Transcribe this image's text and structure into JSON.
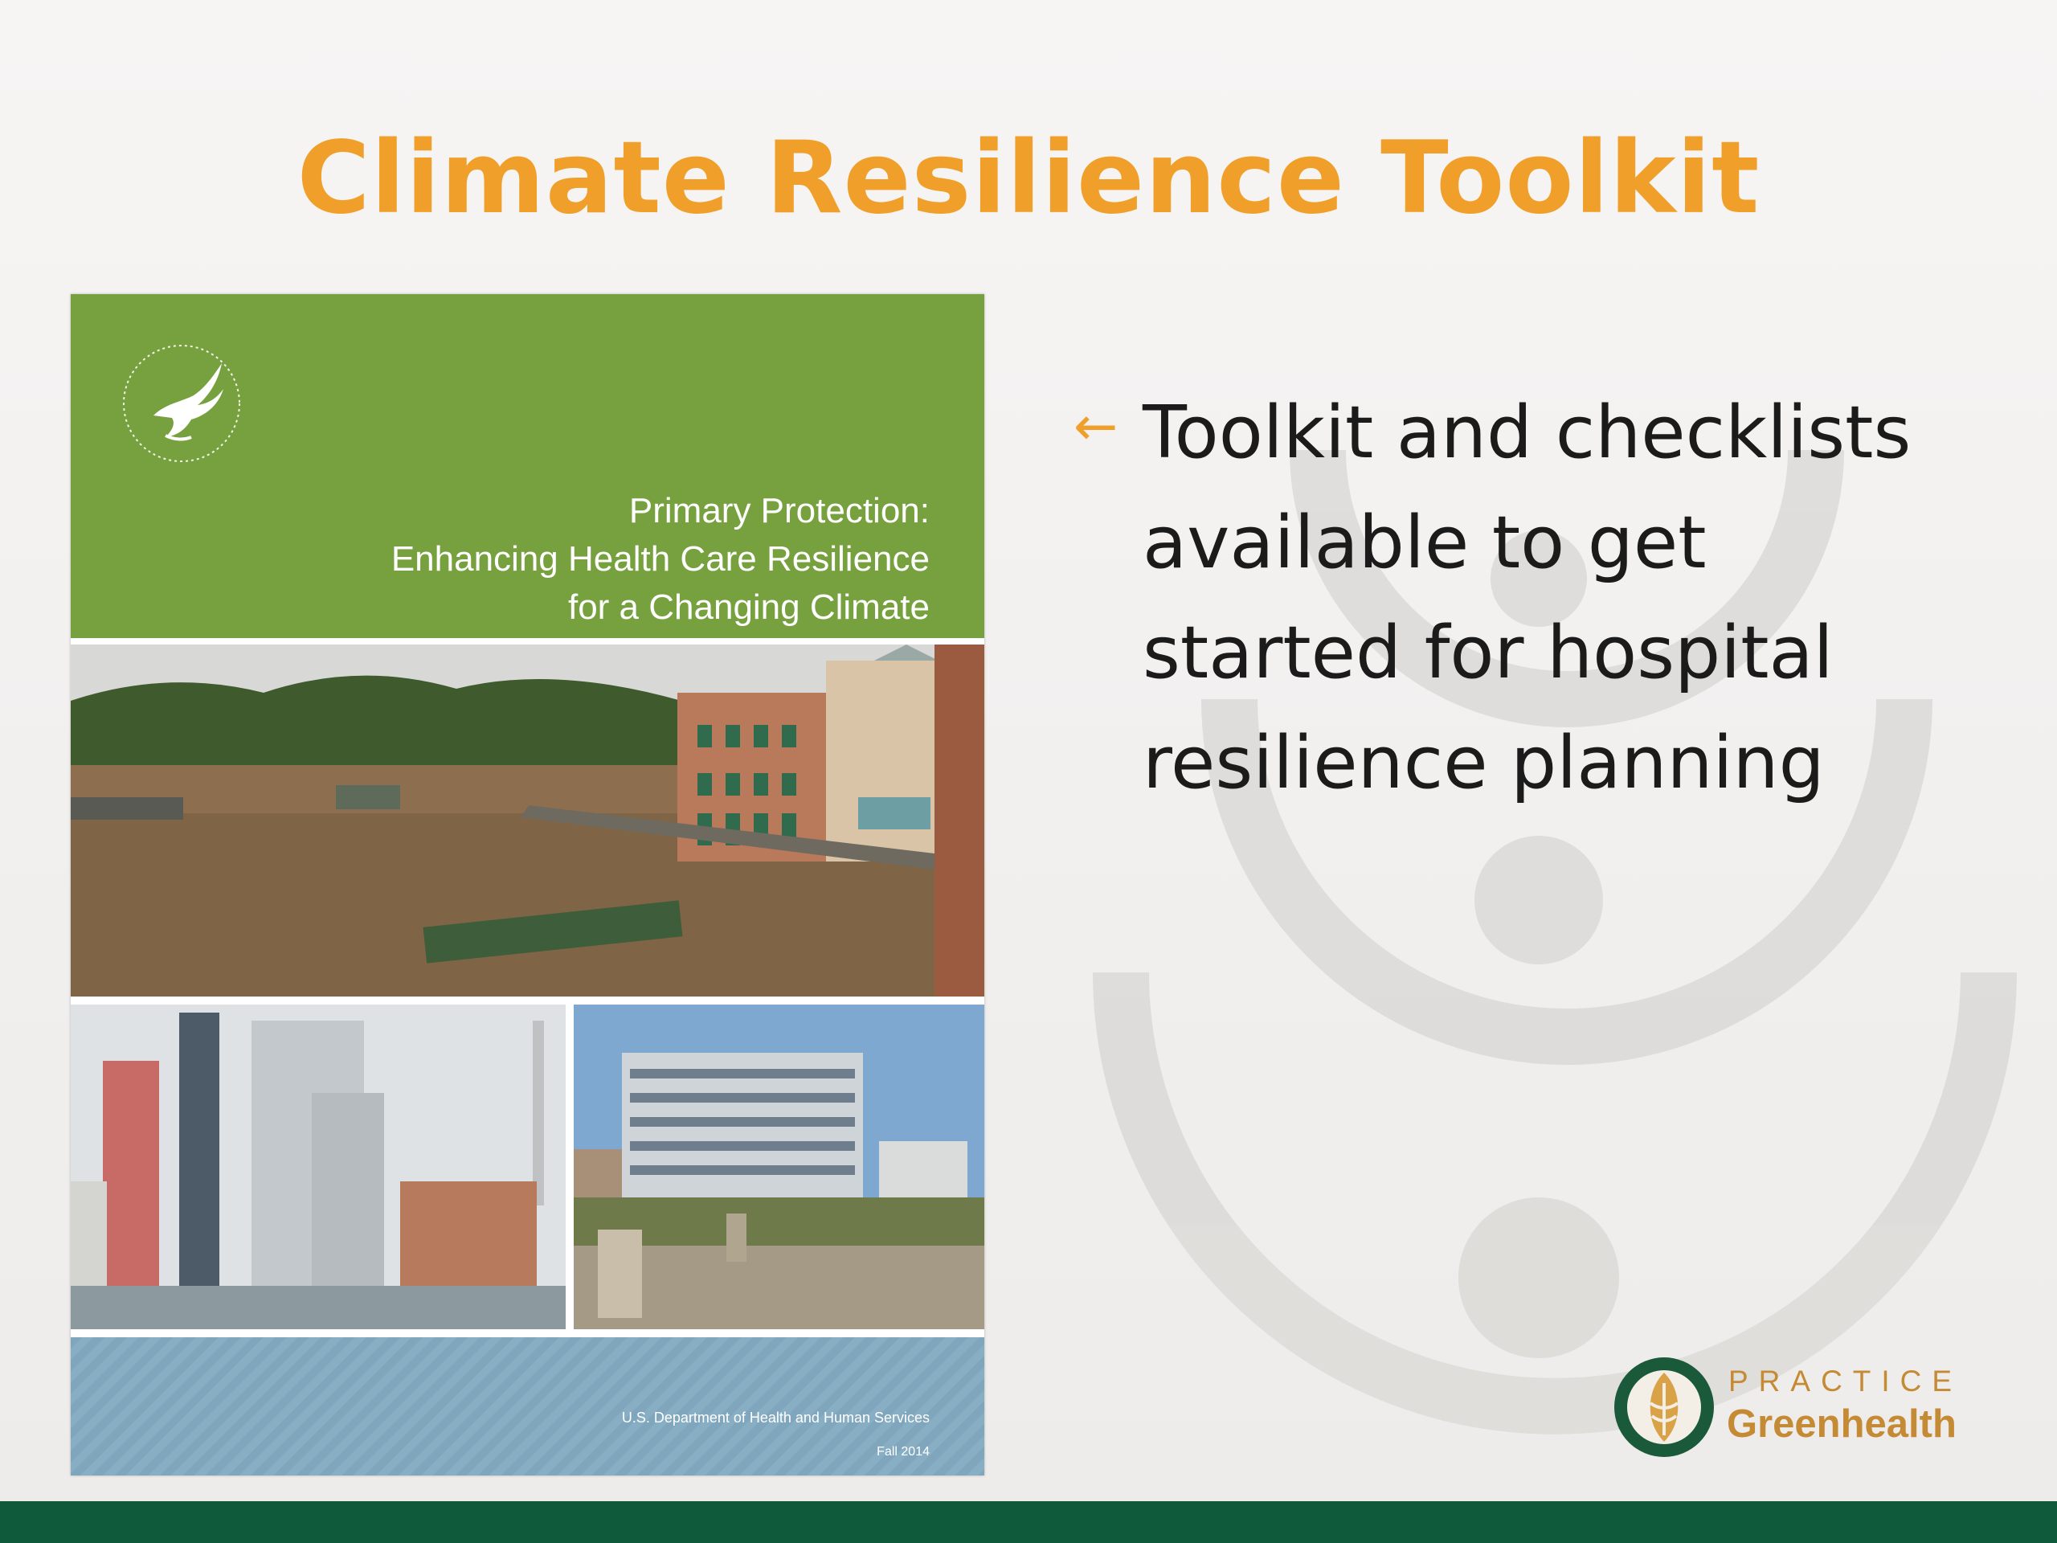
{
  "slide": {
    "title": "Climate Resilience Toolkit",
    "bullet": {
      "icon": "arrow-left-icon",
      "text": "Toolkit and checklists\navailable to get\nstarted for hospital\nresilience planning"
    }
  },
  "cover": {
    "title_lines": [
      "Primary Protection:",
      "Enhancing Health Care Resilience",
      "for a Changing Climate"
    ],
    "department": "U.S. Department of Health and Human Services",
    "date": "Fall 2014",
    "seal_icon": "hhs-eagle-seal-icon"
  },
  "logo": {
    "line1": "PRACTICE",
    "line2": "Greenhealth",
    "icon": "greenhealth-leaf-icon"
  },
  "colors": {
    "title": "#f0a02a",
    "cover_green": "#76a13e",
    "footer_green": "#0f5a3b",
    "logo_gold": "#c58a34",
    "cover_blue": "#7fa6bd"
  }
}
